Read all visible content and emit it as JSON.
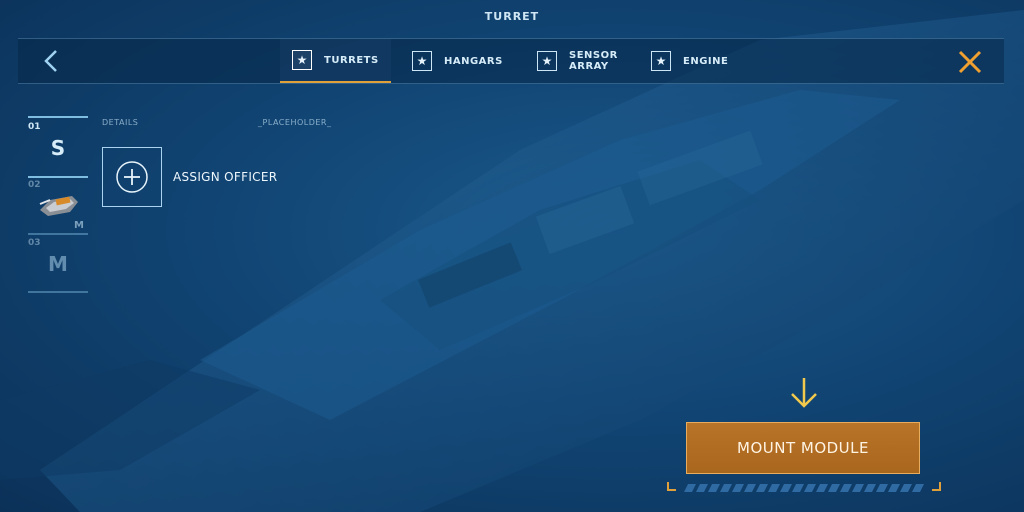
{
  "screen": {
    "title": "TURRET"
  },
  "nav": {
    "tabs": [
      {
        "label": "TURRETS",
        "icon": "star-icon",
        "active": true
      },
      {
        "label": "HANGARS",
        "icon": "star-icon",
        "active": false
      },
      {
        "label": "SENSOR\nARRAY",
        "icon": "star-icon",
        "active": false
      },
      {
        "label": "ENGINE",
        "icon": "star-icon",
        "active": false
      }
    ],
    "back_icon": "chevron-left-icon",
    "close_icon": "close-icon"
  },
  "slots": [
    {
      "number": "01",
      "letter": "S"
    },
    {
      "number": "02",
      "size": "M",
      "icon": "turret-module-icon"
    },
    {
      "number": "03",
      "letter": "M"
    }
  ],
  "details": {
    "label": "DETAILS",
    "placeholder": "_PLACEHOLDER_",
    "assign_label": "ASSIGN OFFICER"
  },
  "action": {
    "mount_label": "MOUNT MODULE",
    "arrow_icon": "arrow-down-icon"
  },
  "colors": {
    "accent": "#e0a03a",
    "close": "#f0a030",
    "button": "#b06e22",
    "background": "#114574"
  }
}
